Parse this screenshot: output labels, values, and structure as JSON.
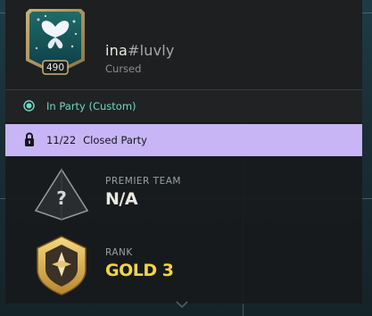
{
  "player": {
    "name": "ina",
    "tag": "#luvly",
    "title": "Cursed",
    "level": "490"
  },
  "status": {
    "text": "In Party (Custom)",
    "color": "#6fd7c2"
  },
  "party": {
    "count": "11/22",
    "label": "Closed Party",
    "color": "#c7b5f6"
  },
  "premier": {
    "label": "PREMIER TEAM",
    "value": "N/A",
    "icon": "premier-unknown-icon"
  },
  "rank": {
    "label": "RANK",
    "value": "GOLD 3",
    "color": "#f2d44a",
    "icon": "gold-rank-icon"
  }
}
